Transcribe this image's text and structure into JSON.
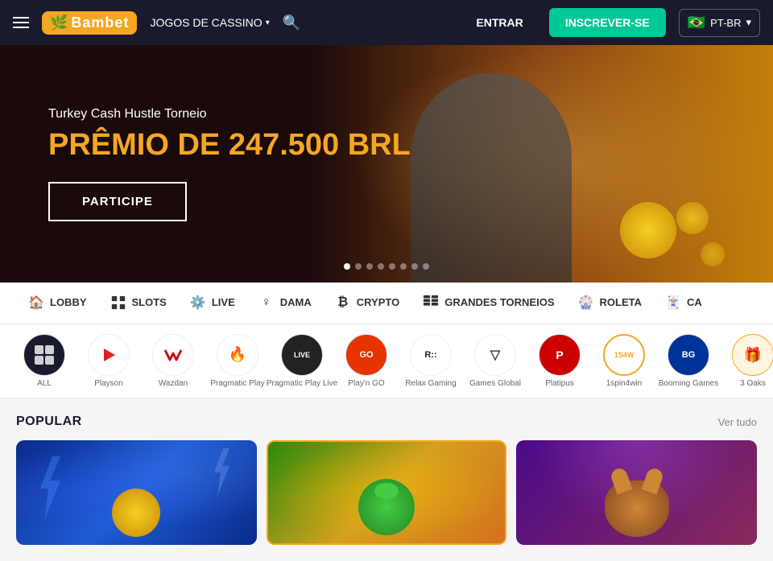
{
  "header": {
    "logo_text": "Bambet",
    "logo_leaf": "🌿",
    "nav_games": "JOGOS DE CASSINO",
    "btn_login": "ENTRAR",
    "btn_register": "INSCREVER-SE",
    "lang": "PT-BR",
    "flag": "🇧🇷"
  },
  "banner": {
    "subtitle": "Turkey Cash Hustle Torneio",
    "title_prefix": "PRÊMIO DE ",
    "title_highlight": "247.500 BRL",
    "cta": "PARTICIPE",
    "dots": [
      true,
      false,
      false,
      false,
      false,
      false,
      false,
      false
    ]
  },
  "categories": [
    {
      "id": "lobby",
      "label": "LOBBY",
      "icon": "🏠"
    },
    {
      "id": "slots",
      "label": "SLOTS",
      "icon": "🎰"
    },
    {
      "id": "live",
      "label": "LIVE",
      "icon": "⚙️"
    },
    {
      "id": "dama",
      "label": "DAMA",
      "icon": "♀"
    },
    {
      "id": "crypto",
      "label": "CRYPTO",
      "icon": "₿"
    },
    {
      "id": "grandes-torneios",
      "label": "GRANDES TORNEIOS",
      "icon": "🎮"
    },
    {
      "id": "roleta",
      "label": "ROLETA",
      "icon": "🎡"
    },
    {
      "id": "ca",
      "label": "CA",
      "icon": "🃏"
    }
  ],
  "providers": [
    {
      "id": "all",
      "name": "ALL",
      "type": "all"
    },
    {
      "id": "playson",
      "name": "Playson",
      "color": "#e31e1e",
      "text": "▶"
    },
    {
      "id": "wazdan",
      "name": "Wazdan",
      "color": "#cc1111",
      "text": "W"
    },
    {
      "id": "pragmatic-play",
      "name": "Pragmatic Play",
      "color": "#f5a623",
      "text": "🔥"
    },
    {
      "id": "pragmatic-play-live",
      "name": "Pragmatic Play Live",
      "color": "#333",
      "text": "LIVE"
    },
    {
      "id": "playn-go",
      "name": "Play'n GO",
      "color": "#e63300",
      "text": "GO"
    },
    {
      "id": "relax-gaming",
      "name": "Relax Gaming",
      "color": "#222",
      "text": "R::"
    },
    {
      "id": "games-global",
      "name": "Games Global",
      "color": "#444",
      "text": "▽"
    },
    {
      "id": "platipus",
      "name": "Platipus",
      "color": "#cc0000",
      "text": "P"
    },
    {
      "id": "1spin4win",
      "name": "1spin4win",
      "color": "#f5a623",
      "text": "1S"
    },
    {
      "id": "booming-games",
      "name": "Booming Games",
      "color": "#003399",
      "text": "BG"
    },
    {
      "id": "3oaks",
      "name": "3 Oaks",
      "color": "#f5a623",
      "text": "🎁"
    }
  ],
  "popular": {
    "title": "POPULAR",
    "see_all": "Ver tudo",
    "games": [
      {
        "id": "game-1",
        "bg": "lightning"
      },
      {
        "id": "game-2",
        "bg": "frog"
      },
      {
        "id": "game-3",
        "bg": "buffalo"
      }
    ]
  }
}
